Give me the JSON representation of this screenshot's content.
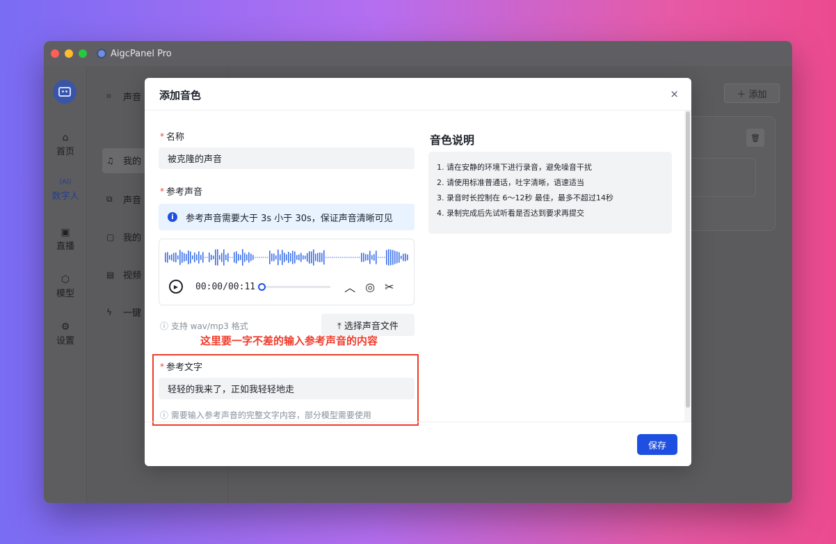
{
  "window": {
    "title": "AigcPanel Pro"
  },
  "nav_rail": [
    {
      "icon": "home-icon",
      "label": "首页"
    },
    {
      "icon": "ai-icon",
      "label": "数字人"
    },
    {
      "icon": "tv-icon",
      "label": "直播"
    },
    {
      "icon": "cube-icon",
      "label": "模型"
    },
    {
      "icon": "gear-icon",
      "label": "设置"
    }
  ],
  "side_menu": [
    {
      "label": "声音",
      "icon": "scan-icon"
    },
    {
      "label": "我的",
      "icon": "user-voice-icon"
    },
    {
      "label": "声音",
      "icon": "copy-icon"
    },
    {
      "label": "我的",
      "icon": "video-icon"
    },
    {
      "label": "视频",
      "icon": "film-icon"
    },
    {
      "label": "一键",
      "icon": "bolt-icon"
    }
  ],
  "content": {
    "add_button": "＋ 添加"
  },
  "modal": {
    "title": "添加音色",
    "close": "×",
    "name_label": "名称",
    "name_value": "被克隆的声音",
    "ref_audio_label": "参考声音",
    "ref_audio_info": "参考声音需要大于 3s 小于 30s，保证声音清晰可见",
    "player_time": "00:00/00:11",
    "format_hint": "ⓘ 支持 wav/mp3 格式",
    "select_file_button": "⤒  选择声音文件",
    "annotation": "这里要一字不差的输入参考声音的内容",
    "ref_text_label": "参考文字",
    "ref_text_value": "轻轻的我来了，正如我轻轻地走",
    "ref_text_hint": "ⓘ 需要输入参考声音的完整文字内容，部分模型需要使用",
    "save_button": "保存",
    "description": {
      "title": "音色说明",
      "lines": [
        "1. 请在安静的环境下进行录音，避免噪音干扰",
        "2. 请使用标准普通话，吐字清晰，语速适当",
        "3. 录音时长控制在 6～12秒 最佳，最多不超过14秒",
        "4. 录制完成后先试听看是否达到要求再提交"
      ]
    }
  },
  "colors": {
    "primary": "#1f4fe0",
    "annotation_red": "#f03b2b",
    "waveform": "#3b6fe8"
  }
}
